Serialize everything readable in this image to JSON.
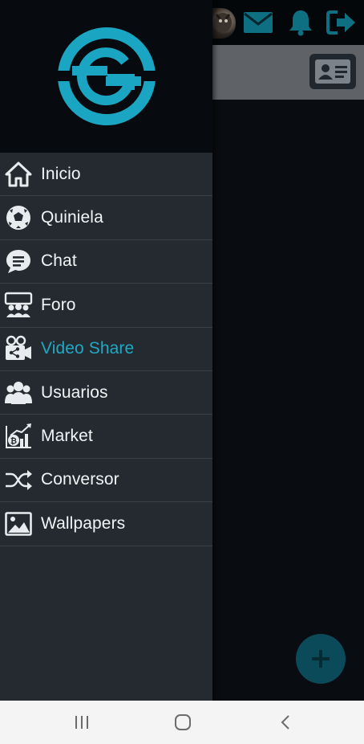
{
  "app": {
    "brand_logo": "sg-circle-logo",
    "accent_color": "#1fa9c4",
    "topbar_icons": [
      "user-avatar",
      "mail-icon",
      "bell-icon",
      "logout-icon"
    ]
  },
  "drawer": {
    "items": [
      {
        "label": "Inicio",
        "icon": "home-icon",
        "active": false
      },
      {
        "label": "Quiniela",
        "icon": "soccer-ball-icon",
        "active": false
      },
      {
        "label": "Chat",
        "icon": "chat-bubble-icon",
        "active": false
      },
      {
        "label": "Foro",
        "icon": "forum-group-icon",
        "active": false
      },
      {
        "label": "Video Share",
        "icon": "video-camera-share-icon",
        "active": true
      },
      {
        "label": "Usuarios",
        "icon": "users-icon",
        "active": false
      },
      {
        "label": "Market",
        "icon": "bitcoin-chart-icon",
        "active": false
      },
      {
        "label": "Conversor",
        "icon": "shuffle-icon",
        "active": false
      },
      {
        "label": "Wallpapers",
        "icon": "image-icon",
        "active": false
      }
    ]
  },
  "fab": {
    "icon": "plus-icon"
  },
  "system_nav": {
    "buttons": [
      "recents-icon",
      "home-circle-icon",
      "back-icon"
    ]
  }
}
